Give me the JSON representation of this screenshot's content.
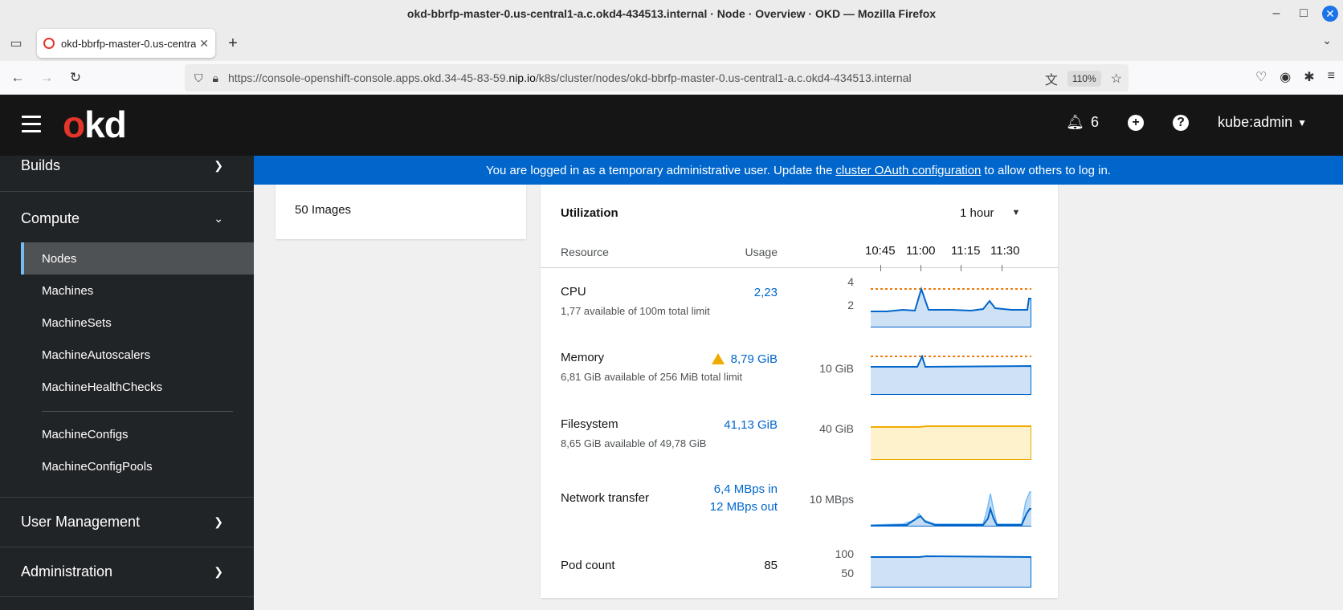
{
  "window": {
    "title": "okd-bbrfp-master-0.us-central1-a.c.okd4-434513.internal · Node · Overview · OKD — Mozilla Firefox"
  },
  "browser": {
    "tab_title": "okd-bbrfp-master-0.us-central1-a.c.okd4-434513.internal",
    "url_prefix": "https://console-openshift-console.apps.okd.34-45-83-59.",
    "url_domain": "nip.io",
    "url_suffix": "/k8s/cluster/nodes/okd-bbrfp-master-0.us-central1-a.c.okd4-434513.internal",
    "zoom": "110%"
  },
  "masthead": {
    "logo_o": "o",
    "logo_kd": "kd",
    "notifications": "6",
    "user": "kube:admin"
  },
  "sidebar": {
    "builds": "Builds",
    "compute": "Compute",
    "items": [
      "Nodes",
      "Machines",
      "MachineSets",
      "MachineAutoscalers",
      "MachineHealthChecks",
      "MachineConfigs",
      "MachineConfigPools"
    ],
    "user_management": "User Management",
    "administration": "Administration"
  },
  "banner": {
    "before": "You are logged in as a temporary administrative user. Update the",
    "link": "cluster OAuth configuration",
    "after": "to allow others to log in."
  },
  "images_card": {
    "label": "50 Images"
  },
  "utilization": {
    "title": "Utilization",
    "range": "1 hour",
    "col_resource": "Resource",
    "col_usage": "Usage",
    "time_ticks": [
      "10:45",
      "11:00",
      "11:15",
      "11:30"
    ],
    "colors": {
      "blue": "#06c",
      "blue_fill": "#cfe2f5",
      "gold": "#f0ab00",
      "gold_fill": "#fdf2cc",
      "limit": "#ec7a08"
    },
    "rows": [
      {
        "name": "CPU",
        "usage": "2,23",
        "sub": "1,77 available of 100m total limit",
        "axis": [
          "4",
          "2"
        ]
      },
      {
        "name": "Memory",
        "usage": "8,79 GiB",
        "sub": "6,81 GiB available of 256 MiB total limit",
        "axis": [
          "10 GiB"
        ]
      },
      {
        "name": "Filesystem",
        "usage": "41,13 GiB",
        "sub": "8,65 GiB available of 49,78 GiB",
        "axis": [
          "40 GiB"
        ]
      },
      {
        "name": "Network transfer",
        "usage_in": "6,4 MBps in",
        "usage_out": "12 MBps out",
        "axis": [
          "10 MBps"
        ]
      },
      {
        "name": "Pod count",
        "usage": "85",
        "axis": [
          "100",
          "50"
        ]
      }
    ]
  }
}
